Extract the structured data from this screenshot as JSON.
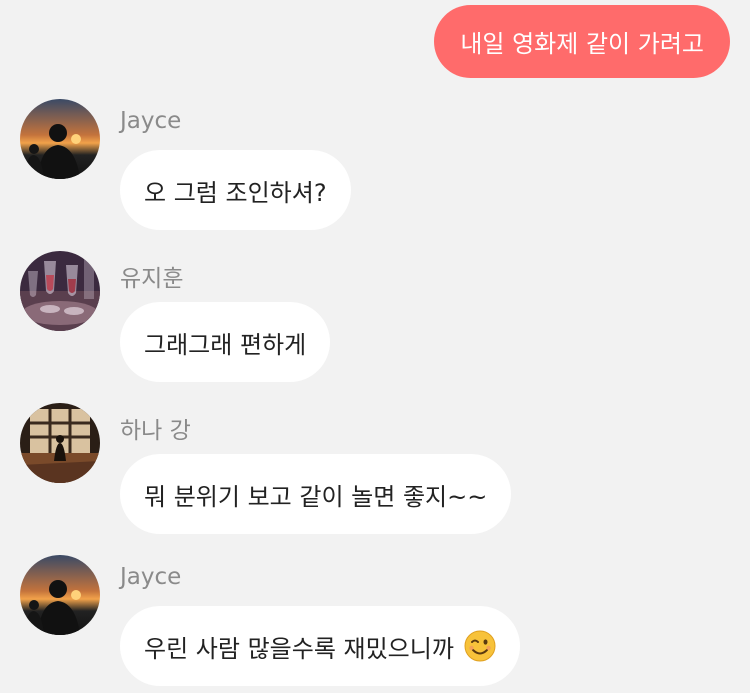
{
  "messages": [
    {
      "type": "outgoing",
      "text": "내일 영화제 같이 가려고"
    },
    {
      "type": "incoming",
      "sender": "Jayce",
      "avatar": "sunset-silhouette-avatar",
      "text": "오 그럼 조인하셔?"
    },
    {
      "type": "incoming",
      "sender": "유지훈",
      "avatar": "wine-glasses-avatar",
      "text": "그래그래 편하게"
    },
    {
      "type": "incoming",
      "sender": "하나 강",
      "avatar": "window-silhouette-avatar",
      "text": "뭐 분위기 보고 같이 놀면 좋지~~"
    },
    {
      "type": "incoming",
      "sender": "Jayce",
      "avatar": "sunset-silhouette-avatar",
      "text": "우린 사람 많을수록 재밌으니까",
      "emoji": "winking-face-icon"
    }
  ],
  "colors": {
    "background": "#f2f2f2",
    "outgoing_bubble": "#ff6b6b",
    "incoming_bubble": "#ffffff",
    "sender_name": "#8a8a8a"
  }
}
